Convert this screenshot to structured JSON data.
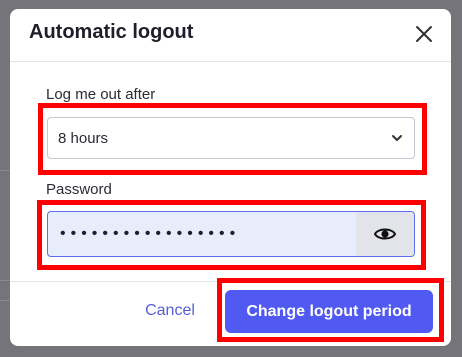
{
  "dialog": {
    "title": "Automatic logout"
  },
  "logout_period": {
    "label": "Log me out after",
    "selected_value": "8 hours"
  },
  "password": {
    "label": "Password",
    "masked_value": "•••••••••••••••••"
  },
  "footer": {
    "cancel_label": "Cancel",
    "primary_label": "Change logout period"
  },
  "icons": {
    "close": "close-icon",
    "chevron": "chevron-down-icon",
    "eye": "eye-icon"
  },
  "colors": {
    "accent": "#5059f2",
    "highlight": "#ff0000",
    "cancel_text": "#5560d9"
  }
}
